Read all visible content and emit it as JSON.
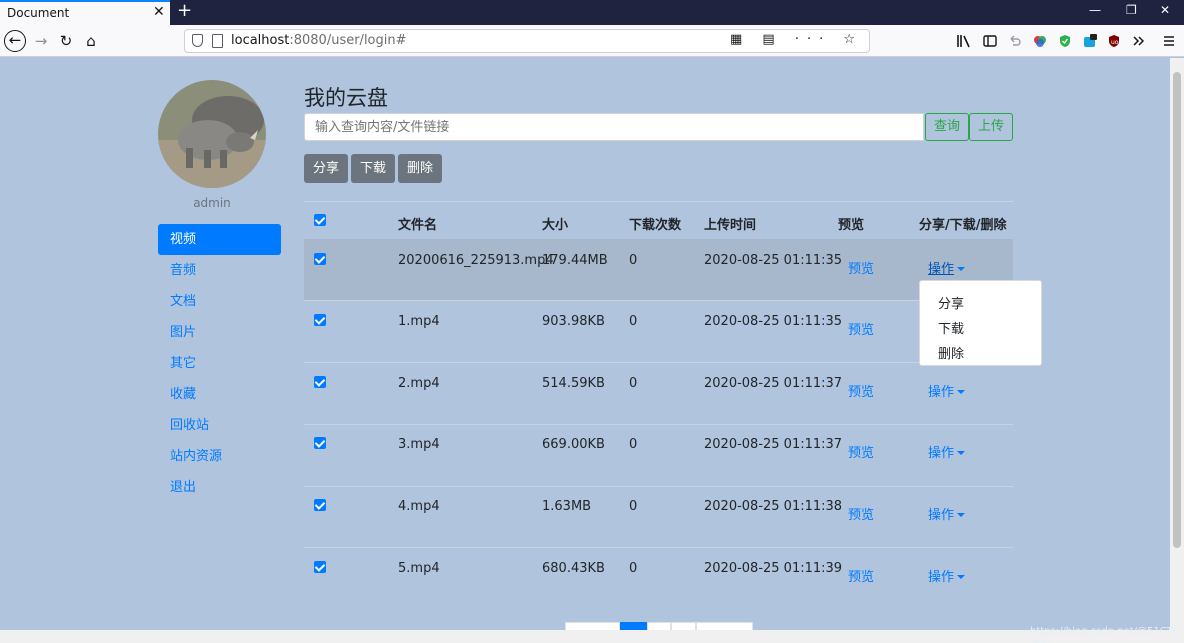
{
  "browser": {
    "tab_title": "Document",
    "tab_close": "✕",
    "new_tab": "+",
    "url_host": "localhost",
    "url_rest": ":8080/user/login#",
    "win_min": "—",
    "win_max": "❐",
    "win_close": "✕"
  },
  "user": {
    "name": "admin"
  },
  "sidebar": {
    "items": [
      {
        "label": "视频",
        "active": true
      },
      {
        "label": "音频"
      },
      {
        "label": "文档"
      },
      {
        "label": "图片"
      },
      {
        "label": "其它"
      },
      {
        "label": "收藏"
      },
      {
        "label": "回收站"
      },
      {
        "label": "站内资源"
      },
      {
        "label": "退出"
      }
    ]
  },
  "main": {
    "title": "我的云盘",
    "search_placeholder": "输入查询内容/文件链接",
    "query_label": "查询",
    "upload_label": "上传",
    "share_label": "分享",
    "download_label": "下载",
    "delete_label": "删除"
  },
  "table": {
    "headers": [
      "文件名",
      "大小",
      "下载次数",
      "上传时间",
      "预览",
      "分享/下载/删除"
    ],
    "preview_label": "预览",
    "ops_label": "操作",
    "rows": [
      {
        "name": "20200616_225913.mp4",
        "size": "179.44MB",
        "downloads": "0",
        "uploaded": "2020-08-25 01:11:35"
      },
      {
        "name": "1.mp4",
        "size": "903.98KB",
        "downloads": "0",
        "uploaded": "2020-08-25 01:11:35"
      },
      {
        "name": "2.mp4",
        "size": "514.59KB",
        "downloads": "0",
        "uploaded": "2020-08-25 01:11:37"
      },
      {
        "name": "3.mp4",
        "size": "669.00KB",
        "downloads": "0",
        "uploaded": "2020-08-25 01:11:37"
      },
      {
        "name": "4.mp4",
        "size": "1.63MB",
        "downloads": "0",
        "uploaded": "2020-08-25 01:11:38"
      },
      {
        "name": "5.mp4",
        "size": "680.43KB",
        "downloads": "0",
        "uploaded": "2020-08-25 01:11:39"
      }
    ]
  },
  "dropdown": {
    "items": [
      "分享",
      "下载",
      "删除"
    ]
  },
  "watermark": "https://blog.csdn.net/@51CTO博客"
}
